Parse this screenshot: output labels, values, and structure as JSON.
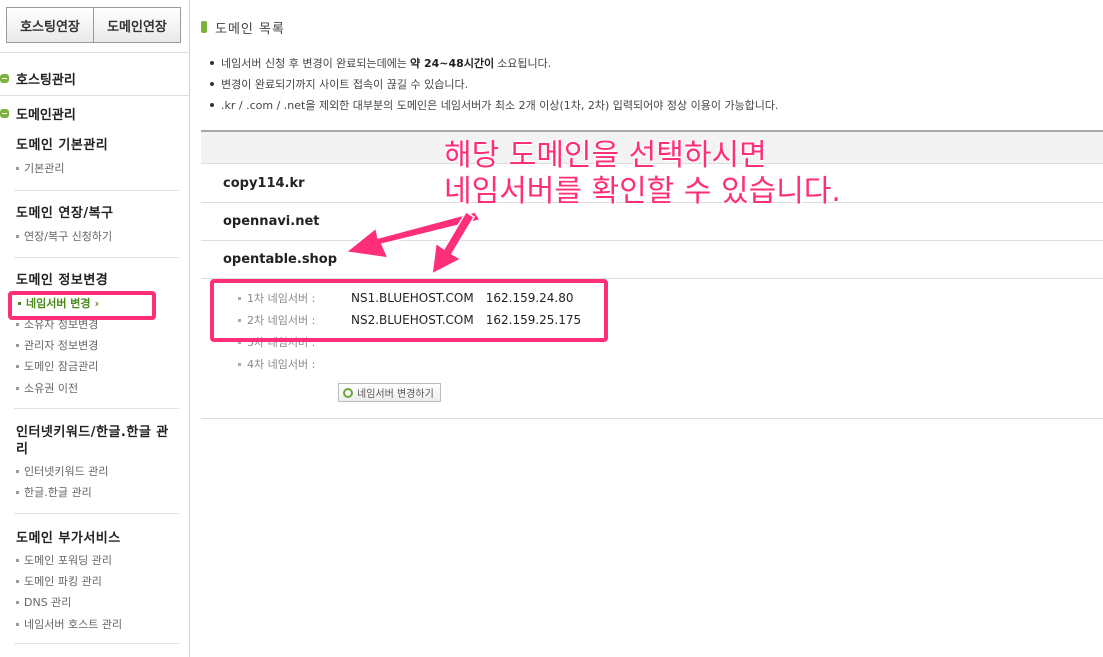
{
  "sidebar": {
    "top_buttons": [
      "호스팅연장",
      "도메인연장"
    ],
    "sections": [
      "호스팅관리",
      "도메인관리"
    ],
    "groups": [
      {
        "title": "도메인 기본관리",
        "items": [
          "기본관리"
        ]
      },
      {
        "title": "도메인 연장/복구",
        "items": [
          "연장/복구 신청하기"
        ]
      },
      {
        "title": "도메인 정보변경",
        "items": [
          "네임서버 변경",
          "소유자 정보변경",
          "관리자 정보변경",
          "도메인 잠금관리",
          "소유권 이전"
        ]
      },
      {
        "title": "인터넷키워드/한글.한글 관리",
        "items": [
          "인터넷키워드 관리",
          "한글.한글 관리"
        ]
      },
      {
        "title": "도메인 부가서비스",
        "items": [
          "도메인 포워딩 관리",
          "도메인 파킹 관리",
          "DNS 관리",
          "네임서버 호스트 관리"
        ]
      }
    ],
    "active_item": "네임서버 변경"
  },
  "main": {
    "title": "도메인 목록",
    "notes": [
      {
        "before": "네임서버 신청 후 변경이 완료되는데에는",
        "bold": "약 24~48시간이",
        "after": "소요됩니다."
      },
      {
        "text": "변경이 완료되기까지 사이트 접속이 끊길 수 있습니다."
      },
      {
        "text": ".kr / .com / .net을 제외한 대부분의 도메인은 네임서버가 최소 2개 이상(1차, 2차) 입력되어야 정상 이용이 가능합니다."
      }
    ],
    "domains": [
      "copy114.kr",
      "opennavi.net",
      "opentable.shop"
    ],
    "nameservers": [
      {
        "label": "1차 네임서버 :",
        "host": "NS1.BLUEHOST.COM",
        "ip": "162.159.24.80"
      },
      {
        "label": "2차 네임서버 :",
        "host": "NS2.BLUEHOST.COM",
        "ip": "162.159.25.175"
      },
      {
        "label": "3차 네임서버 :",
        "host": "",
        "ip": ""
      },
      {
        "label": "4차 네임서버 :",
        "host": "",
        "ip": ""
      }
    ],
    "change_button": "네임서버 변경하기"
  },
  "annotation": {
    "line1": "해당 도메인을 선택하시면",
    "line2": "네임서버를 확인할 수 있습니다.",
    "color": "#ff2e79"
  }
}
